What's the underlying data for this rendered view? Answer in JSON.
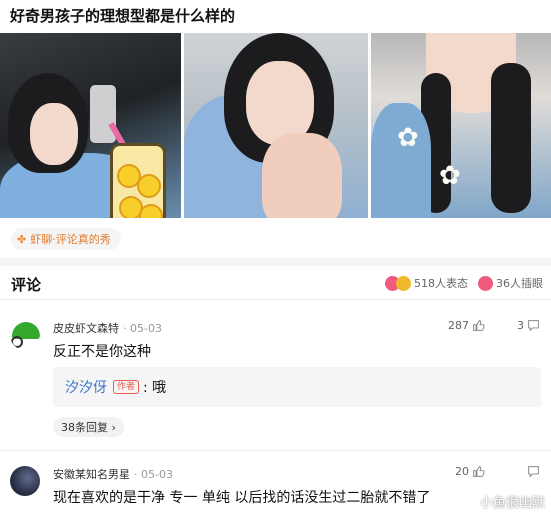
{
  "post": {
    "title": "好奇男孩子的理想型都是什么样的",
    "tag": "虾聊·评论真的秀"
  },
  "comments_section": {
    "heading": "评论",
    "reactions_count": "518人表态",
    "illustrations_count": "36人插眼"
  },
  "comments": [
    {
      "author": "皮皮虾文森特",
      "date": "· 05-03",
      "text": "反正不是你这种",
      "likes": "287",
      "replies_count": "3",
      "reply": {
        "author": "汐汐伢",
        "badge": "作者",
        "text": ": 哦"
      },
      "more_replies": "38条回复 ›"
    },
    {
      "author": "安徽某知名男星",
      "date": "· 05-03",
      "text": "现在喜欢的是干净 专一 单纯 以后找的话没生过二胎就不错了",
      "likes": "20",
      "replies_count": ""
    }
  ],
  "watermark": "小鱼很幽默",
  "colors": {
    "accent_orange": "#e07a2c",
    "link_blue": "#3f76c7",
    "author_badge": "#e85d4f"
  }
}
